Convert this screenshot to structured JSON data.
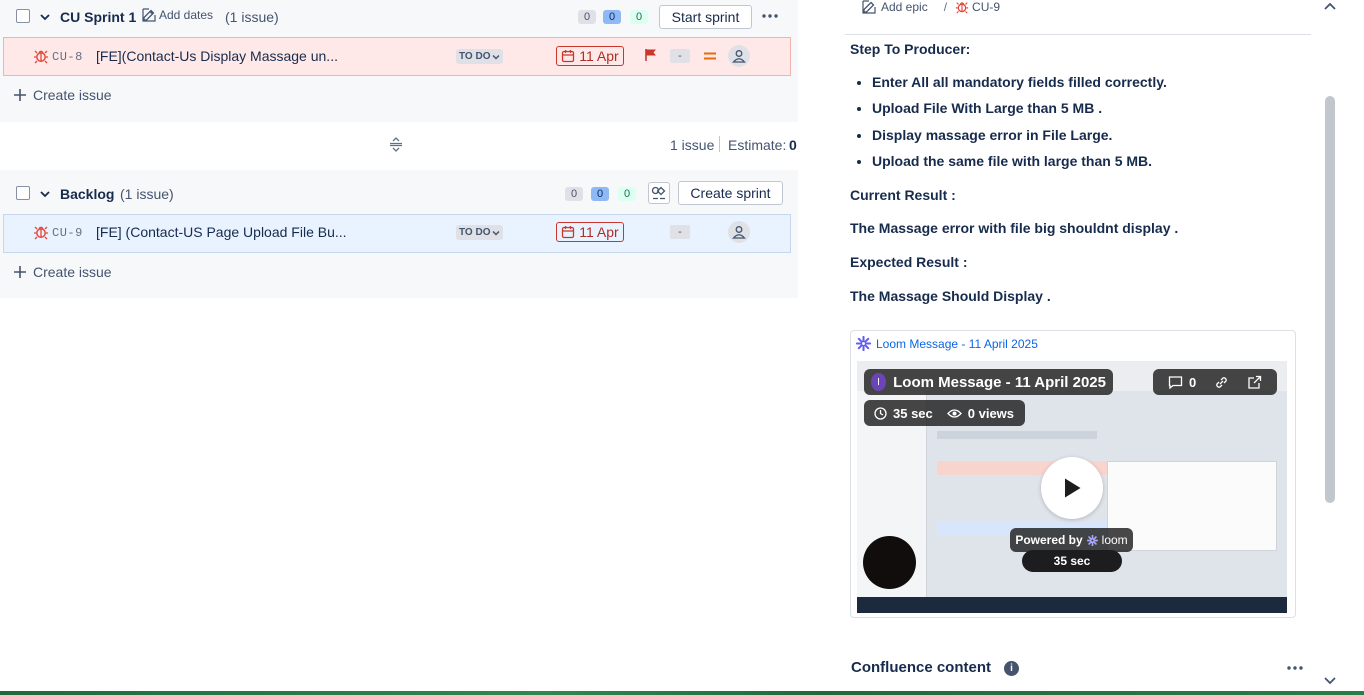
{
  "sprint": {
    "name": "CU Sprint 1",
    "add_dates_label": "Add dates",
    "issue_count": "(1 issue)",
    "counts": [
      "0",
      "0",
      "0"
    ],
    "start_button": "Start sprint",
    "issues": [
      {
        "key": "CU-8",
        "summary": "[FE](Contact-Us Display Massage un...",
        "status": "TO DO",
        "due": "11 Apr",
        "estimate": "-"
      }
    ],
    "create_issue": "Create issue",
    "footer_count": "1 issue",
    "estimate_label": "Estimate:",
    "estimate_value": "0"
  },
  "backlog": {
    "name": "Backlog",
    "issue_count": "(1 issue)",
    "counts": [
      "0",
      "0",
      "0"
    ],
    "create_sprint_button": "Create sprint",
    "issues": [
      {
        "key": "CU-9",
        "summary": "[FE] (Contact-US Page Upload File Bu...",
        "status": "TO DO",
        "due": "11 Apr",
        "estimate": "-"
      }
    ],
    "create_issue": "Create issue"
  },
  "detail": {
    "add_epic": "Add epic",
    "separator": "/",
    "issue_key": "CU-9",
    "steps_heading": "Step To Producer:",
    "steps": [
      "Enter All all mandatory fields filled correctly.",
      "Upload File With Large than 5 MB .",
      " Display massage error in File Large.",
      " Upload the same file with large than 5 MB."
    ],
    "current_heading": "Current Result :",
    "current_text": "The Massage error with file big shouldnt display .",
    "expected_heading": "Expected Result :",
    "expected_text": "The Massage Should Display .",
    "loom": {
      "link_text": "Loom Message - 11 April 2025",
      "video_title": "Loom Message - 11 April 2025",
      "avatar_initial": "I",
      "comments": "0",
      "duration": "35 sec",
      "views": "0 views",
      "powered_by": "Powered by",
      "brand": "loom",
      "duration_badge": "35 sec"
    },
    "confluence_heading": "Confluence content"
  },
  "colors": {
    "bug_red": "#e2483d",
    "flag_red": "#c9372c",
    "priority_orange": "#e56910",
    "link_blue": "#0c66e4"
  }
}
